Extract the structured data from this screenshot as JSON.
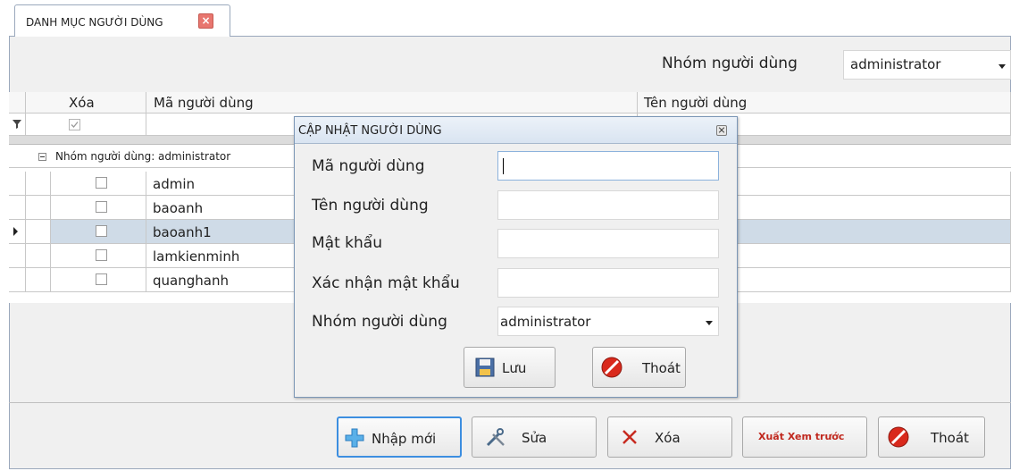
{
  "tab": {
    "title": "DANH MỤC NGƯỜI DÙNG"
  },
  "filter": {
    "label": "Nhóm người dùng",
    "value": "administrator"
  },
  "grid": {
    "columns": [
      "Xóa",
      "Mã người dùng",
      "Tên người dùng"
    ],
    "group_label": "Nhóm người dùng: administrator",
    "rows": [
      {
        "code": "admin"
      },
      {
        "code": "baoanh"
      },
      {
        "code": "baoanh1"
      },
      {
        "code": "lamkienminh"
      },
      {
        "code": "quanghanh"
      }
    ],
    "selected_row": 2
  },
  "dialog": {
    "title": "CẬP NHẬT NGƯỜI DÙNG",
    "fields": [
      {
        "label": "Mã người dùng",
        "value": ""
      },
      {
        "label": "Tên người dùng",
        "value": ""
      },
      {
        "label": "Mật khẩu",
        "value": ""
      },
      {
        "label": "Xác nhận mật khẩu",
        "value": ""
      }
    ],
    "group_label": "Nhóm người dùng",
    "group_value": "administrator",
    "save_label": "Lưu",
    "exit_label": "Thoát"
  },
  "toolbar": {
    "new_label": "Nhập mới",
    "edit_label": "Sửa",
    "delete_label": "Xóa",
    "preview_label": "Xuất Xem trước",
    "exit_label": "Thoát"
  },
  "colors": {
    "preview_text": "#c0281e",
    "selected_row": "#cfdbe7",
    "accent": "#3c8ee0"
  }
}
